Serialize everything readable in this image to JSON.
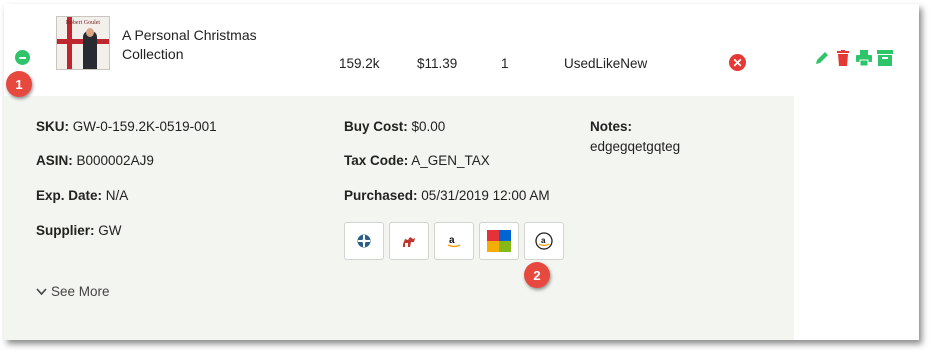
{
  "row": {
    "title": "A Personal Christmas Collection",
    "sales_rank": "159.2k",
    "price": "$11.39",
    "quantity": "1",
    "condition": "UsedLikeNew",
    "cover_text": "Robert Goulet",
    "remove_symbol": "✕"
  },
  "details": {
    "sku_label": "SKU:",
    "sku": "GW-0-159.2K-0519-001",
    "asin_label": "ASIN:",
    "asin": "B000002AJ9",
    "exp_label": "Exp. Date:",
    "exp": "N/A",
    "supplier_label": "Supplier:",
    "supplier": "GW",
    "buy_cost_label": "Buy Cost:",
    "buy_cost": "$0.00",
    "tax_code_label": "Tax Code:",
    "tax_code": "A_GEN_TAX",
    "purchased_label": "Purchased:",
    "purchased": "05/31/2019 12:00 AM",
    "notes_label": "Notes:",
    "notes": "edgegqetgqteg",
    "see_more": "See More"
  },
  "marketplaces": [
    "keepa-icon",
    "camelcamelcamel-icon",
    "amazon-icon",
    "ebay-icon",
    "amazon-smile-icon"
  ],
  "actions": [
    "edit-icon",
    "delete-icon",
    "print-icon",
    "archive-icon"
  ],
  "callouts": {
    "one": "1",
    "two": "2"
  },
  "colors": {
    "green": "#2ec46a",
    "red": "#e53935",
    "badge": "#e8493f",
    "detail_bg": "#f3f5f1"
  }
}
